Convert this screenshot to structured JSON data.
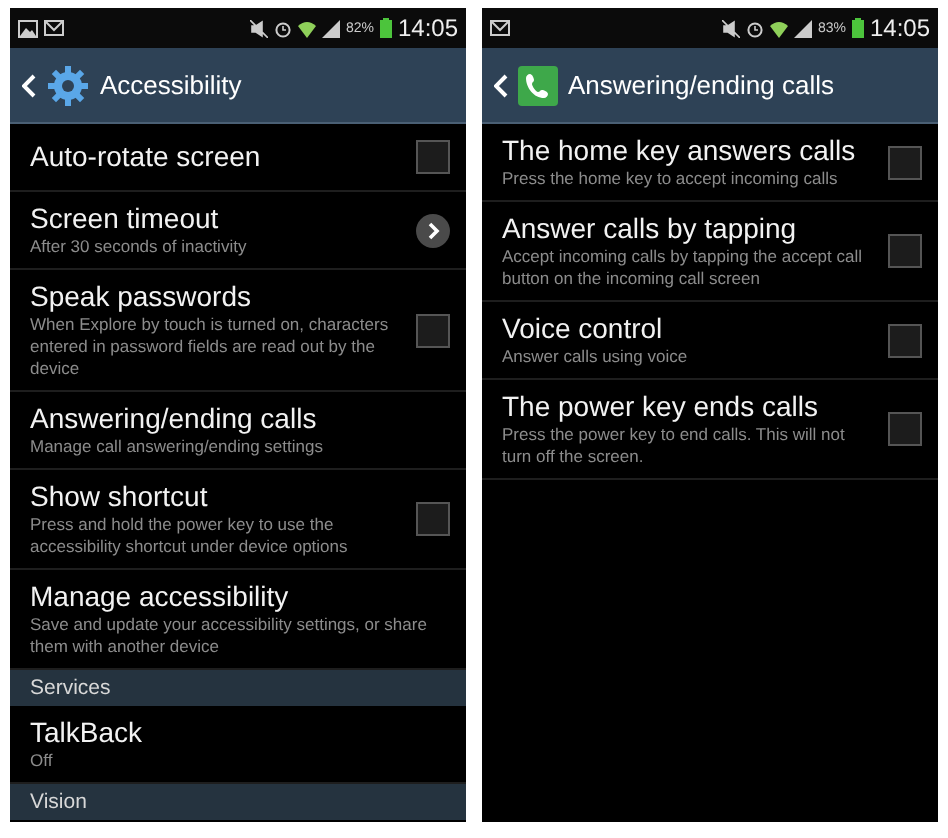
{
  "screens": [
    {
      "status_bar": {
        "notifications": [
          {
            "kind": "picture"
          },
          {
            "kind": "mail"
          }
        ],
        "battery": "82%",
        "time": "14:05"
      },
      "action_bar": {
        "icon": {
          "kind": "gear"
        },
        "title": "Accessibility"
      },
      "items": [
        {
          "kind": "checkbox",
          "title": "Auto-rotate screen",
          "checked": false
        },
        {
          "kind": "arrow",
          "title": "Screen timeout",
          "subtitle": "After 30 seconds of inactivity"
        },
        {
          "kind": "checkbox",
          "title": "Speak passwords",
          "subtitle": "When Explore by touch is turned on, characters entered in password fields are read out by the device",
          "checked": false
        },
        {
          "kind": "plain",
          "title": "Answering/ending calls",
          "subtitle": "Manage call answering/ending settings"
        },
        {
          "kind": "checkbox",
          "title": "Show shortcut",
          "subtitle": "Press and hold the power key to use the accessibility shortcut under device options",
          "checked": false
        },
        {
          "kind": "plain",
          "title": "Manage accessibility",
          "subtitle": "Save and update your accessibility settings, or share them with another device"
        },
        {
          "kind": "header",
          "title": "Services"
        },
        {
          "kind": "plain",
          "title": "TalkBack",
          "subtitle": "Off"
        },
        {
          "kind": "header",
          "title": "Vision"
        }
      ]
    },
    {
      "status_bar": {
        "notifications": [
          {
            "kind": "mail"
          }
        ],
        "battery": "83%",
        "time": "14:05"
      },
      "action_bar": {
        "icon": {
          "kind": "phone"
        },
        "title": "Answering/ending calls"
      },
      "items": [
        {
          "kind": "checkbox",
          "title": "The home key answers calls",
          "subtitle": "Press the home key to accept incoming calls",
          "checked": false
        },
        {
          "kind": "checkbox",
          "title": "Answer calls by tapping",
          "subtitle": "Accept incoming calls by tapping the accept call button on the incoming call screen",
          "checked": false
        },
        {
          "kind": "checkbox",
          "title": "Voice control",
          "subtitle": "Answer calls using voice",
          "checked": false
        },
        {
          "kind": "checkbox",
          "title": "The power key ends calls",
          "subtitle": "Press the power key to end calls. This will not turn off the screen.",
          "checked": false
        }
      ]
    }
  ]
}
